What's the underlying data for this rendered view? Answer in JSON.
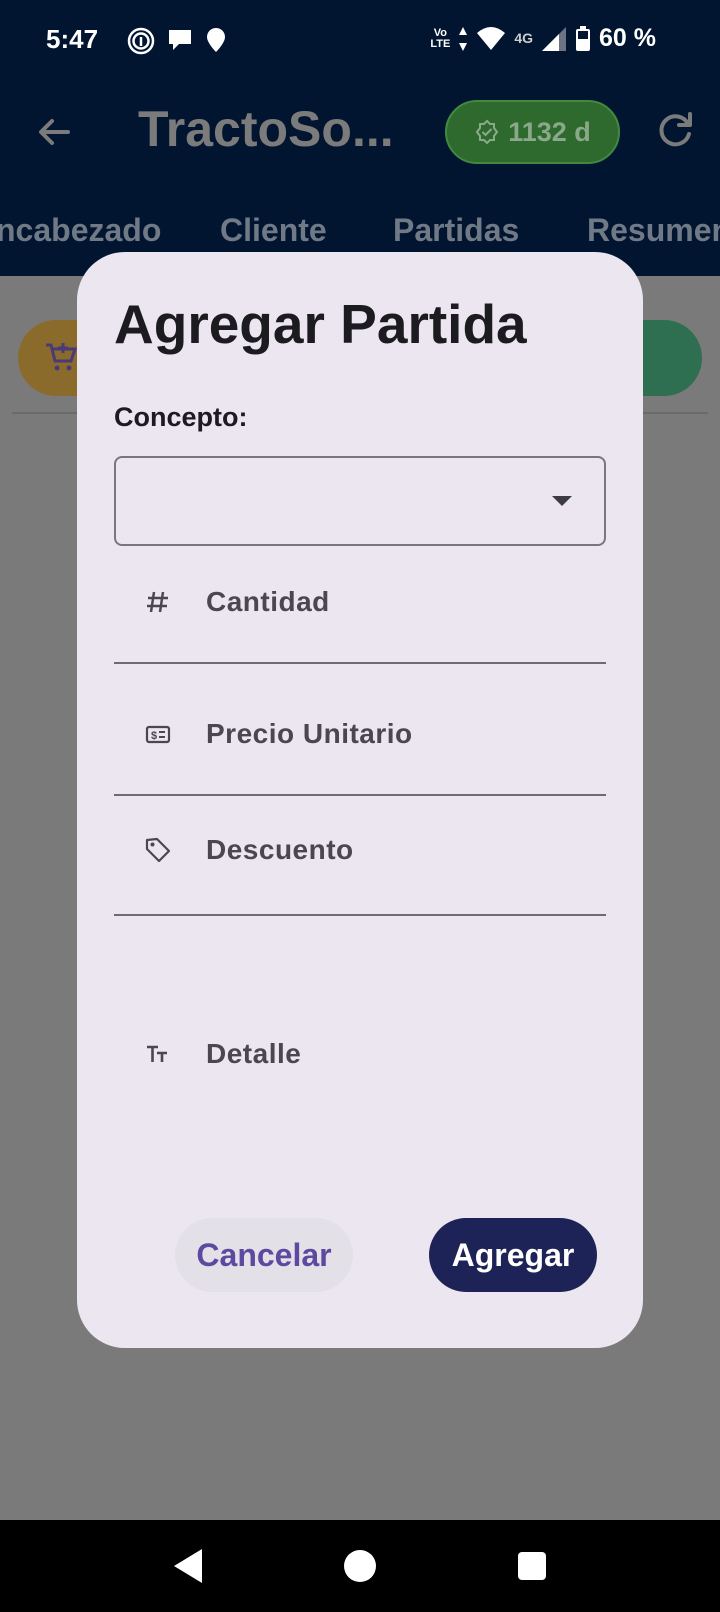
{
  "status_bar": {
    "time": "5:47",
    "volte_top": "Vo",
    "volte_bottom": "LTE",
    "network": "4G",
    "battery": "60 %",
    "icons_left": [
      "fingerprint-icon",
      "chat-bubble-icon",
      "location-pin-icon"
    ],
    "icons_right": [
      "data-arrows-icon",
      "wifi-icon",
      "signal-icon",
      "battery-icon"
    ]
  },
  "app_bar": {
    "title": "TractoSo...",
    "badge_text": "1132 d",
    "badge_color": "#2e6a2e"
  },
  "tabs": [
    {
      "label": "ncabezado"
    },
    {
      "label": "Cliente"
    },
    {
      "label": "Partidas"
    },
    {
      "label": "Resumen"
    }
  ],
  "dialog": {
    "title": "Agregar Partida",
    "concept_label": "Concepto:",
    "concept_value": "",
    "fields": [
      {
        "label": "Cantidad",
        "icon": "hash-icon"
      },
      {
        "label": "Precio Unitario",
        "icon": "money-icon"
      },
      {
        "label": "Descuento",
        "icon": "tag-icon"
      },
      {
        "label": "Detalle",
        "icon": "text-format-icon"
      }
    ],
    "cancel_label": "Cancelar",
    "add_label": "Agregar",
    "accent_color": "#1e2357"
  }
}
